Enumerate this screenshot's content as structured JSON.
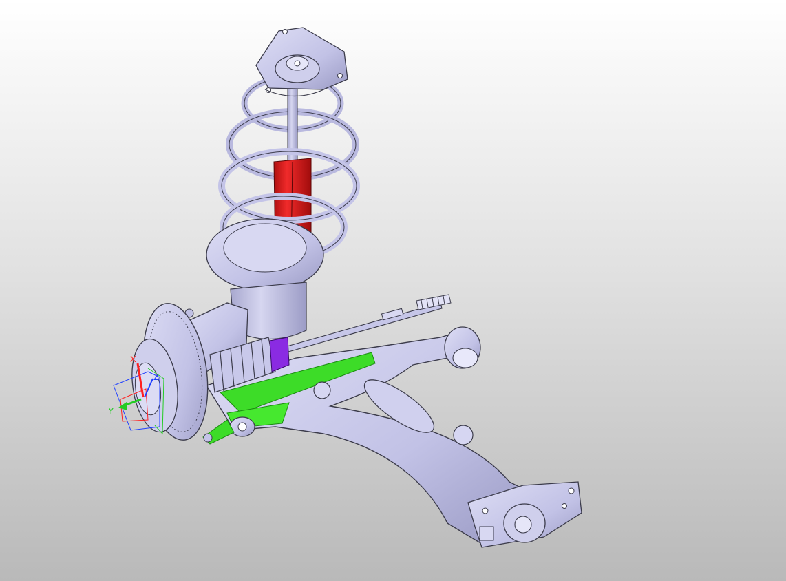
{
  "triad": {
    "x_label": "X",
    "y_label": "Y",
    "z_label": "Z"
  },
  "colors": {
    "part": "#c4c4e8",
    "part_dark": "#8f8fba",
    "edge": "#3b3b4a",
    "damper": "#e02020",
    "selected_face": "#3ddc28",
    "boot_clamp": "#8a2be2",
    "axis_x": "#ff2020",
    "axis_y": "#22cc22",
    "axis_z": "#2040ff"
  }
}
